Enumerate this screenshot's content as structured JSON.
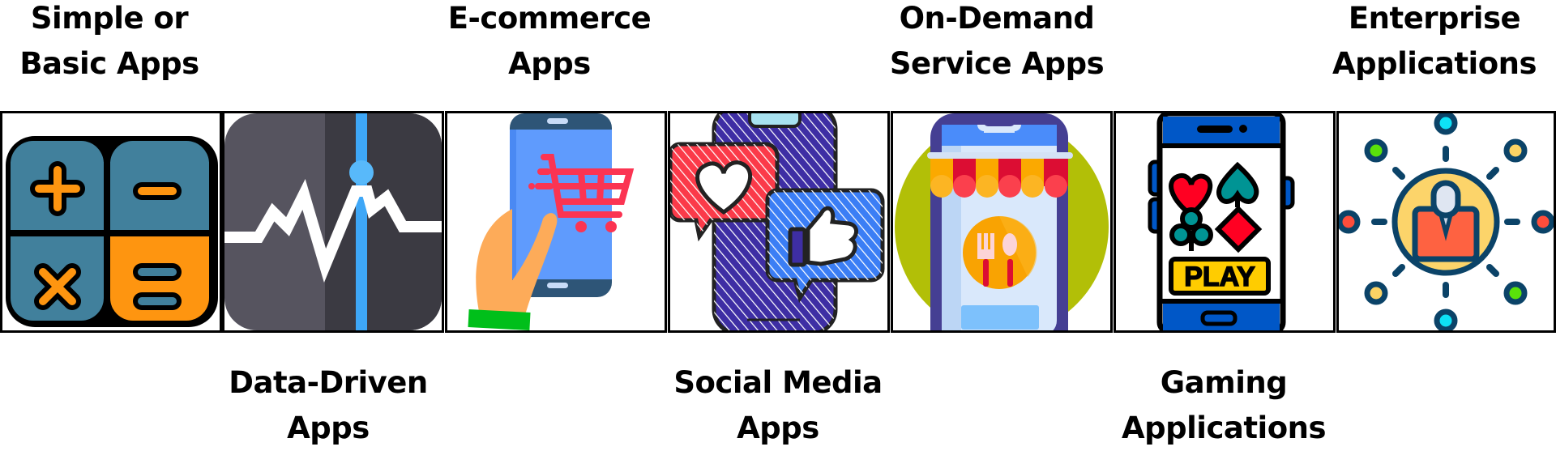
{
  "categories": [
    {
      "id": "simple",
      "label": "Simple or\nBasic Apps",
      "icon": "calculator-icon",
      "label_position": "top"
    },
    {
      "id": "data",
      "label": "Data-Driven\nApps",
      "icon": "line-chart-icon",
      "label_position": "bottom"
    },
    {
      "id": "ecommerce",
      "label": "E-commerce\nApps",
      "icon": "phone-shopping-cart-icon",
      "label_position": "top"
    },
    {
      "id": "social",
      "label": "Social Media\nApps",
      "icon": "phone-like-heart-icon",
      "label_position": "bottom"
    },
    {
      "id": "ondemand",
      "label": "On-Demand\nService Apps",
      "icon": "phone-store-food-icon",
      "label_position": "top"
    },
    {
      "id": "gaming",
      "label": "Gaming\nApplications",
      "icon": "phone-cards-play-icon",
      "label_position": "bottom"
    },
    {
      "id": "enterprise",
      "label": "Enterprise\nApplications",
      "icon": "network-user-icon",
      "label_position": "top"
    }
  ],
  "icon_text": {
    "play": "PLAY"
  },
  "colors": {
    "border": "#000000",
    "text": "#000000"
  }
}
